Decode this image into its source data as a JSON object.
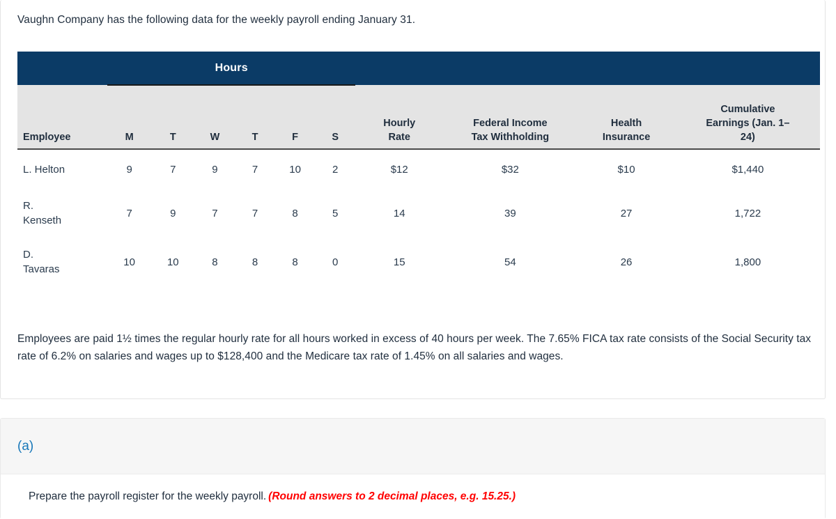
{
  "intro": "Vaughn Company has the following data for the weekly payroll ending January 31.",
  "table": {
    "group_header": "Hours",
    "headers": {
      "employee": "Employee",
      "days": [
        "M",
        "T",
        "W",
        "T",
        "F",
        "S"
      ],
      "hourly_rate": "Hourly\nRate",
      "hourly_rate_line1": "Hourly",
      "hourly_rate_line2": "Rate",
      "federal_line1": "Federal Income",
      "federal_line2": "Tax Withholding",
      "health_line1": "Health",
      "health_line2": "Insurance",
      "cumulative_line1": "Cumulative",
      "cumulative_line2": "Earnings (Jan. 1–",
      "cumulative_line3": "24)"
    },
    "rows": [
      {
        "employee": "L. Helton",
        "employee_line1": "L. Helton",
        "employee_line2": "",
        "m": "9",
        "t1": "7",
        "w": "9",
        "t2": "7",
        "f": "10",
        "s": "2",
        "hourly_rate": "$12",
        "federal_withholding": "$32",
        "health_insurance": "$10",
        "cumulative_earnings": "$1,440"
      },
      {
        "employee": "R. Kenseth",
        "employee_line1": "R.",
        "employee_line2": "Kenseth",
        "m": "7",
        "t1": "9",
        "w": "7",
        "t2": "7",
        "f": "8",
        "s": "5",
        "hourly_rate": "14",
        "federal_withholding": "39",
        "health_insurance": "27",
        "cumulative_earnings": "1,722"
      },
      {
        "employee": "D. Tavaras",
        "employee_line1": "D.",
        "employee_line2": "Tavaras",
        "m": "10",
        "t1": "10",
        "w": "8",
        "t2": "8",
        "f": "8",
        "s": "0",
        "hourly_rate": "15",
        "federal_withholding": "54",
        "health_insurance": "26",
        "cumulative_earnings": "1,800"
      }
    ]
  },
  "explanation": "Employees are paid 1½ times the regular hourly rate for all hours worked in excess of 40 hours per week. The 7.65% FICA tax rate consists of the Social Security tax rate of 6.2% on salaries and wages up to $128,400 and the Medicare tax rate of 1.45% on all salaries and wages.",
  "part": {
    "label": "(a)",
    "instruction": "Prepare the payroll register for the weekly payroll.",
    "round_note": "(Round answers to 2 decimal places, e.g. 15.25.)"
  },
  "colors": {
    "header_band": "#0b3b66",
    "header_row_bg": "#e4e4e4",
    "part_label": "#1878b9",
    "round_note": "#ff0000",
    "text": "#1f2d3d"
  }
}
